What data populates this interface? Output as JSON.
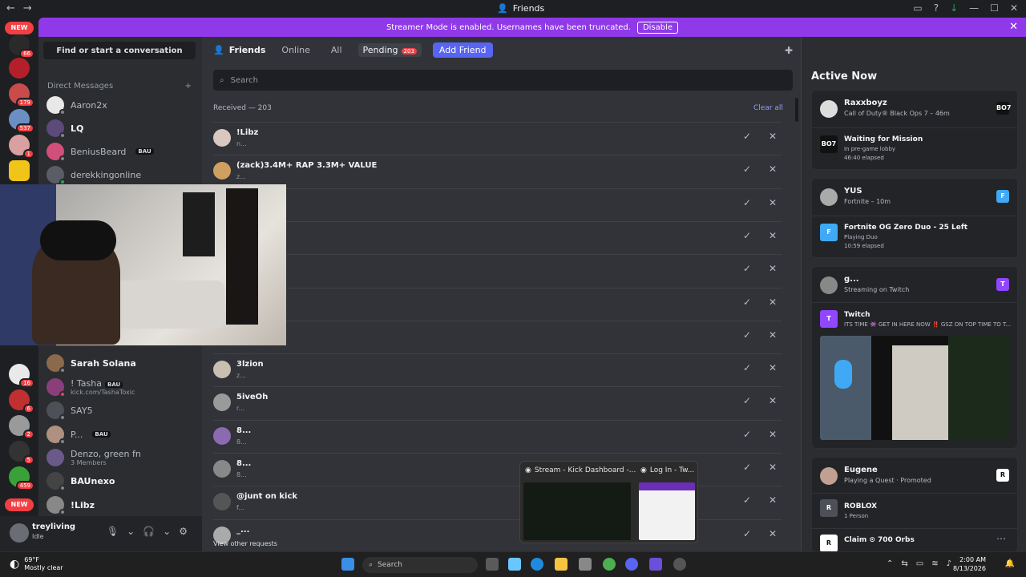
{
  "window": {
    "title": "Friends",
    "nav_back": "←",
    "nav_forward": "→"
  },
  "banner": {
    "message": "Streamer Mode is enabled. Usernames have been truncated.",
    "disable_label": "Disable"
  },
  "guilds": {
    "new_top": "NEW",
    "new_bottom": "NEW",
    "badges": [
      "66",
      "179",
      "537",
      "1",
      "16",
      "6",
      "2",
      "5",
      "459"
    ]
  },
  "sidebar": {
    "search_label": "Find or start a conversation",
    "dm_header": "Direct Messages",
    "dm_add": "+",
    "dms": [
      {
        "name": "Aaron2x",
        "sub": "",
        "bau": false
      },
      {
        "name": "LQ",
        "sub": "",
        "bau": false
      },
      {
        "name": "BeniusBeard",
        "sub": "",
        "bau": true
      },
      {
        "name": "derekkingonline",
        "sub": "",
        "bau": false
      },
      {
        "name": "Sarah Solana",
        "sub": "",
        "bau": false
      },
      {
        "name": "! Tasha",
        "sub": "kick.com/TashaToxic",
        "bau": true
      },
      {
        "name": "SAY5",
        "sub": "",
        "bau": false
      },
      {
        "name": "P...",
        "sub": "",
        "bau": true
      },
      {
        "name": "Denzo, green fn",
        "sub": "3 Members",
        "bau": false
      },
      {
        "name": "BAUnexo",
        "sub": "",
        "bau": false
      },
      {
        "name": "!Libz",
        "sub": "",
        "bau": false
      }
    ],
    "bau_label": "BAU"
  },
  "user": {
    "name": "treyliving",
    "status": "Idle"
  },
  "topnav": {
    "friends_label": "Friends",
    "tabs": [
      "Online",
      "All",
      "Pending"
    ],
    "pending_count": "203",
    "add_friend_label": "Add Friend"
  },
  "search": {
    "placeholder": "Search"
  },
  "requests": {
    "received_label": "Received — 203",
    "clear_all_label": "Clear all",
    "rows": [
      {
        "name": "!Libz",
        "sub": "n..."
      },
      {
        "name": "(zack)3.4M+ RAP 3.3M+ VALUE",
        "sub": "z..."
      },
      {
        "name": "",
        "sub": ""
      },
      {
        "name": "",
        "sub": ""
      },
      {
        "name": "",
        "sub": ""
      },
      {
        "name": "",
        "sub": ""
      },
      {
        "name": "",
        "sub": ""
      },
      {
        "name": "3lzion",
        "sub": "z..."
      },
      {
        "name": "5iveOh",
        "sub": "r..."
      },
      {
        "name": "8...",
        "sub": "8..."
      },
      {
        "name": "8...",
        "sub": "8..."
      },
      {
        "name": "@junt on kick",
        "sub": "f..."
      },
      {
        "name": "_...",
        "sub": ""
      }
    ],
    "accept_glyph": "✓",
    "decline_glyph": "✕",
    "view_other_label": "View other requests"
  },
  "active_now": {
    "title": "Active Now",
    "cards": [
      {
        "name": "Raxxboyz",
        "activity": "Call of Duty® Black Ops 7 – 46m",
        "icon_label": "BO7",
        "detail_title": "Waiting for Mission",
        "detail_sub1": "In pre-game lobby",
        "detail_sub2": "46:40 elapsed"
      },
      {
        "name": "YUS",
        "activity": "Fortnite – 10m",
        "icon_label": "F",
        "detail_title": "Fortnite OG Zero Duo - 25 Left",
        "detail_sub1": "Playing Duo",
        "detail_sub2": "10:59 elapsed"
      },
      {
        "name": "g...",
        "activity": "Streaming on Twitch",
        "icon_label": "T",
        "detail_title": "Twitch",
        "detail_sub1": "ITS TIME 👾 GET IN HERE NOW ‼️ GSZ ON TOP TIME TO T...",
        "detail_sub2": ""
      },
      {
        "name": "Eugene",
        "activity": "Playing a Quest · Promoted",
        "icon_label": "R",
        "detail_title": "ROBLOX",
        "detail_sub1": "1 Person",
        "detail_sub2": ""
      }
    ],
    "claim_label": "Claim ⊙ 700 Orbs"
  },
  "taskbar_previews": [
    {
      "title": "Stream - Kick Dashboard -..."
    },
    {
      "title": "Log In - Tw..."
    }
  ],
  "taskbar": {
    "temp": "69°F",
    "weather": "Mostly clear",
    "search_placeholder": "Search",
    "time": "2:00 AM",
    "date": "8/13/2026"
  },
  "colors": {
    "blurple": "#5865f2",
    "banner": "#8f39e8",
    "danger": "#f23f43"
  }
}
